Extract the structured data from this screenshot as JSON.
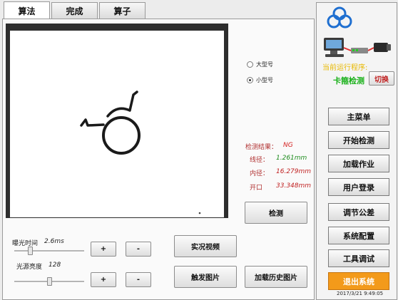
{
  "tabs": [
    {
      "label": "算法",
      "active": true
    },
    {
      "label": "完成",
      "active": false
    },
    {
      "label": "算子",
      "active": false
    }
  ],
  "radios": [
    {
      "label": "大型号",
      "checked": false
    },
    {
      "label": "小型号",
      "checked": true
    }
  ],
  "results": {
    "status_label": "检测结果：",
    "status_value": "NG",
    "wire_label": "线径：",
    "wire_value": "1.261mm",
    "inner_label": "内径：",
    "inner_value": "16.279mm",
    "opening_label": "开口",
    "opening_value": "33.348mm"
  },
  "buttons": {
    "detect": "检测",
    "live_video": "实况视频",
    "trigger_image": "触发图片",
    "load_history": "加载历史图片",
    "plus": "+",
    "minus": "-"
  },
  "sliders": {
    "exposure_label": "曝光时间",
    "exposure_value": "2.6ms",
    "exposure_level": 0.22,
    "brightness_label": "光源亮度",
    "brightness_value": "128",
    "brightness_level": 0.5
  },
  "side": {
    "current_program_label": "当前运行程序:",
    "current_program": "卡箍检测",
    "switch": "切换",
    "menu": [
      "主菜单",
      "开始检测",
      "加载作业",
      "用户登录",
      "调节公差",
      "系统配置",
      "工具调试"
    ],
    "exit": "退出系统",
    "datetime": "2017/3/21 9:49:05"
  },
  "colors": {
    "ng": "#d42020",
    "value_green": "#1a8a1a",
    "value_red": "#c02020",
    "program_green": "#18b018",
    "program_label": "#e8b800",
    "exit": "#f39a1a",
    "logo_blue": "#1f6fd0"
  },
  "icons": {
    "logo": "three-rings-logo-icon",
    "network": "computer-camera-network-icon"
  }
}
